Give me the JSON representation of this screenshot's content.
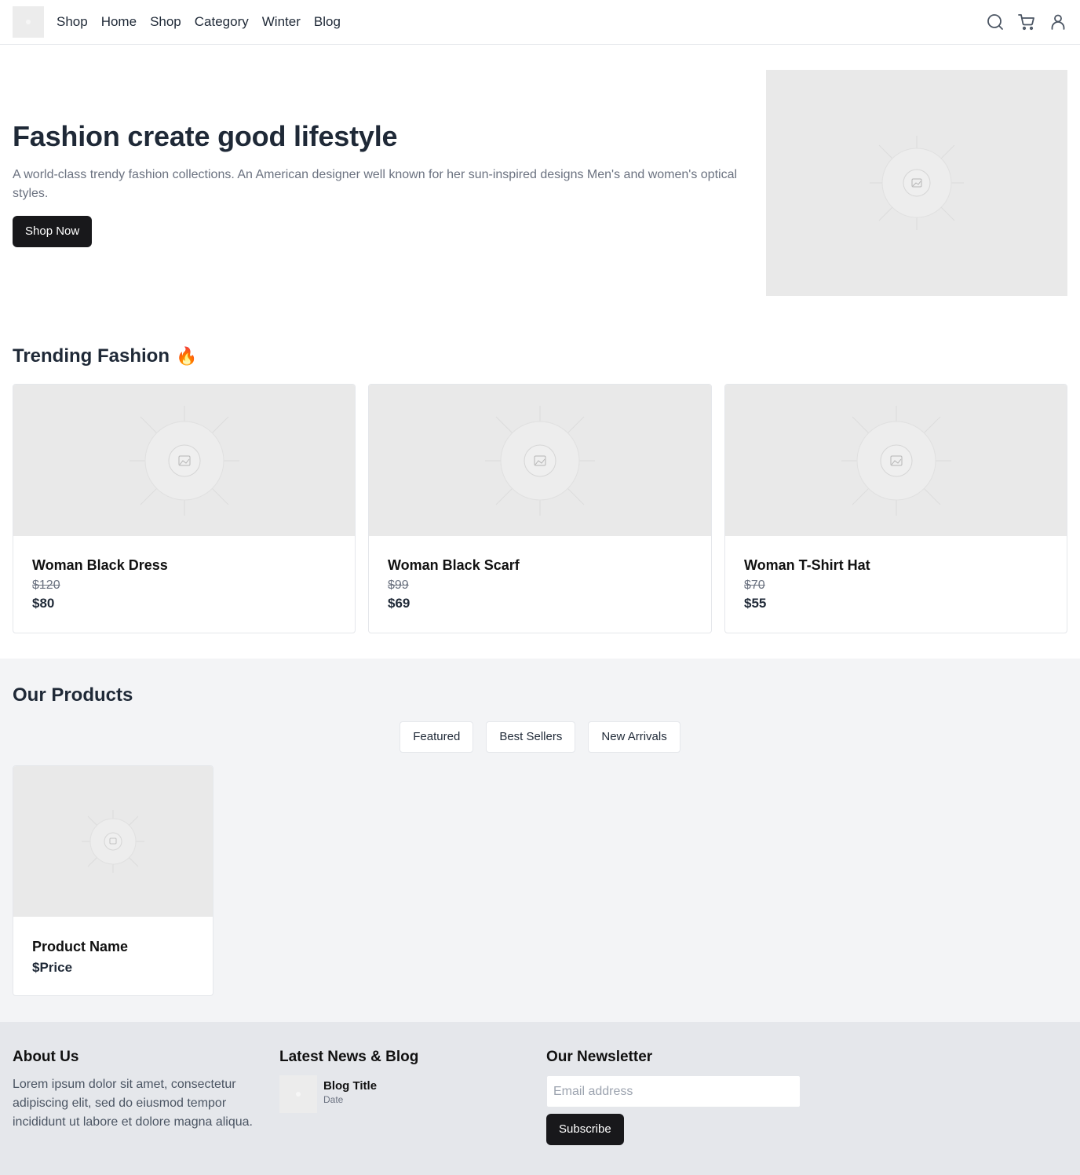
{
  "nav": {
    "logo_icon": "image-placeholder-icon",
    "items": [
      "Shop",
      "Home",
      "Shop",
      "Category",
      "Winter",
      "Blog"
    ],
    "icons": [
      "search-icon",
      "cart-icon",
      "user-icon"
    ]
  },
  "hero": {
    "title": "Fashion create good lifestyle",
    "description": "A world-class trendy fashion collections. An American designer well known for her sun-inspired designs Men's and women's optical styles.",
    "cta": "Shop Now"
  },
  "trending": {
    "title": "Trending Fashion",
    "emoji": "🔥",
    "items": [
      {
        "name": "Woman Black Dress",
        "old_price": "$120",
        "price": "$80"
      },
      {
        "name": "Woman Black Scarf",
        "old_price": "$99",
        "price": "$69"
      },
      {
        "name": "Woman T-Shirt Hat",
        "old_price": "$70",
        "price": "$55"
      }
    ]
  },
  "products": {
    "title": "Our Products",
    "tabs": [
      "Featured",
      "Best Sellers",
      "New Arrivals"
    ],
    "items": [
      {
        "name": "Product Name",
        "price": "$Price"
      }
    ]
  },
  "footer": {
    "about": {
      "title": "About Us",
      "text": "Lorem ipsum dolor sit amet, consectetur adipiscing elit, sed do eiusmod tempor incididunt ut labore et dolore magna aliqua."
    },
    "blog": {
      "title": "Latest News & Blog",
      "items": [
        {
          "title": "Blog Title",
          "date": "Date"
        }
      ]
    },
    "newsletter": {
      "title": "Our Newsletter",
      "placeholder": "Email address",
      "button": "Subscribe"
    }
  },
  "colors": {
    "dark_button": "#18181b",
    "products_bg": "#f3f4f6",
    "footer_bg": "#e5e7eb",
    "placeholder_bg": "#e9e9e9"
  }
}
